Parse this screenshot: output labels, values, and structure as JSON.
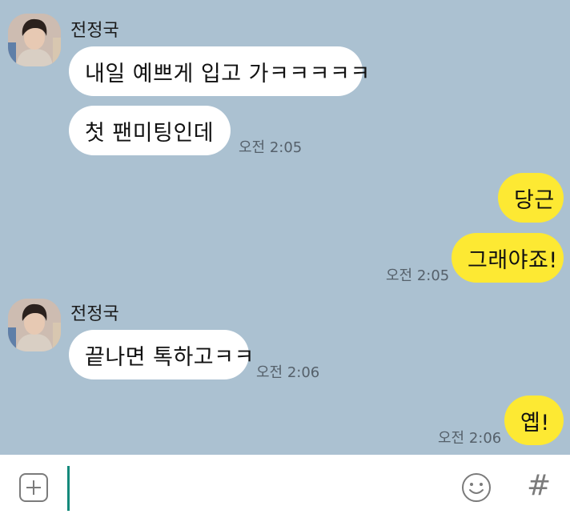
{
  "colors": {
    "chat_background": "#abc1d1",
    "incoming_bubble": "#ffffff",
    "outgoing_bubble": "#fde933",
    "caret": "#14897b"
  },
  "messages": {
    "group1": {
      "sender": "전정국",
      "bubble1": "내일 예쁘게 입고 가ㅋㅋㅋㅋㅋ",
      "bubble2": "첫 팬미팅인데",
      "time": "오전 2:05"
    },
    "group2": {
      "bubble1": "당근",
      "bubble2": "그래야죠!",
      "time": "오전 2:05"
    },
    "group3": {
      "sender": "전정국",
      "bubble1": "끝나면 톡하고ㅋㅋ",
      "time": "오전 2:06"
    },
    "group4": {
      "bubble1": "옙!",
      "time": "오전 2:06"
    }
  },
  "input_bar": {
    "plus_icon": "plus-square-icon",
    "emoji_icon": "smiley-icon",
    "hash_label": "#",
    "text_value": ""
  }
}
